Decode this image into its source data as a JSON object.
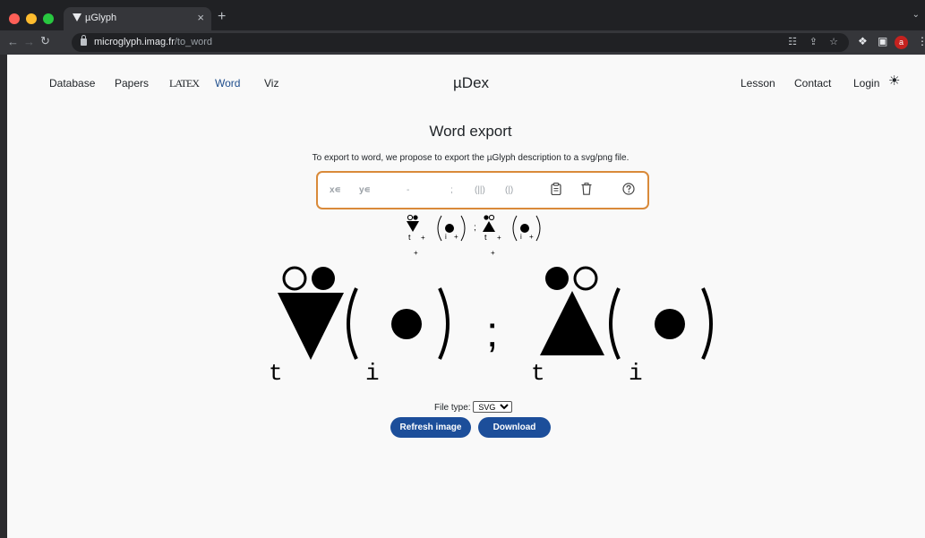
{
  "browser": {
    "tab_title": "µGlyph",
    "tab_close": "×",
    "new_tab": "+",
    "url_domain": "microglyph.imag.fr",
    "url_path": "/to_word",
    "profile_initial": "a",
    "icons": [
      "back-arrow-icon",
      "forward-arrow-icon",
      "reload-icon",
      "lock-icon",
      "translate-icon",
      "share-icon",
      "star-icon",
      "extensions-icon",
      "side-panel-icon",
      "kebab-menu-icon"
    ]
  },
  "nav": {
    "left": [
      {
        "label": "Database"
      },
      {
        "label": "Papers"
      },
      {
        "label": "LATEX"
      },
      {
        "label": "Word",
        "active": true
      },
      {
        "label": "Viz"
      }
    ],
    "brand": "µDex",
    "right": [
      {
        "label": "Lesson"
      },
      {
        "label": "Contact"
      },
      {
        "label": "Login"
      }
    ],
    "theme_icon": "sun-icon"
  },
  "main": {
    "title": "Word export",
    "description": "To export to word, we propose to export the µGlyph description to a svg/png file.",
    "editor": {
      "x_prefix": "x∊",
      "y_prefix": "y∊",
      "dash": "-",
      "semicolon": ";",
      "double_bar": "(||)",
      "single_bar": "(|)",
      "icons": [
        "clipboard-icon",
        "trash-icon",
        "help-circle-icon"
      ]
    },
    "glyph_preview": {
      "small": {
        "t": "t",
        "plus": "+",
        "i": "i",
        "semicolon": ";"
      },
      "large": {
        "t": "t",
        "i": "i",
        "semicolon": ";"
      }
    },
    "file_type_label": "File type:",
    "file_type_value": "SVG",
    "refresh_button": "Refresh image",
    "download_button": "Download"
  },
  "colors": {
    "accent": "#1e4d8c",
    "button": "#1c4e9a",
    "editor_border": "#d98a3a",
    "page_bg": "#f9f9f9"
  }
}
